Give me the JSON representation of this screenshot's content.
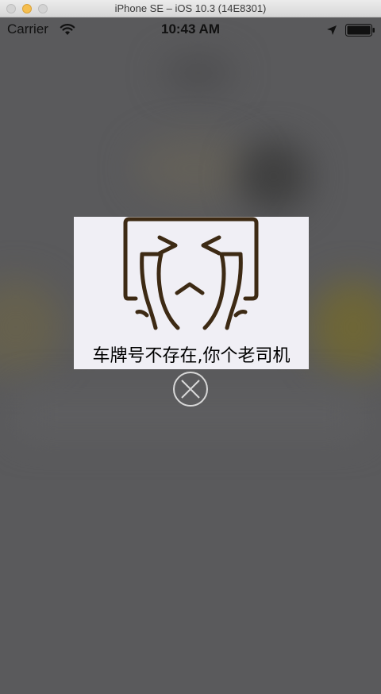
{
  "titlebar": {
    "title": "iPhone SE – iOS 10.3 (14E8301)"
  },
  "statusbar": {
    "carrier": "Carrier",
    "time": "10:43 AM",
    "icons": [
      "wifi-icon",
      "location-icon",
      "battery-icon"
    ]
  },
  "popup": {
    "image": "crying-face-icon",
    "message": "车牌号不存在,你个老司机",
    "close_icon": "close-circle-icon"
  },
  "colors": {
    "overlay": "#5a5a5c",
    "popup_background": "#f0eff5",
    "face_stroke": "#3d2a14",
    "close_icon": "#d8d8d8"
  }
}
